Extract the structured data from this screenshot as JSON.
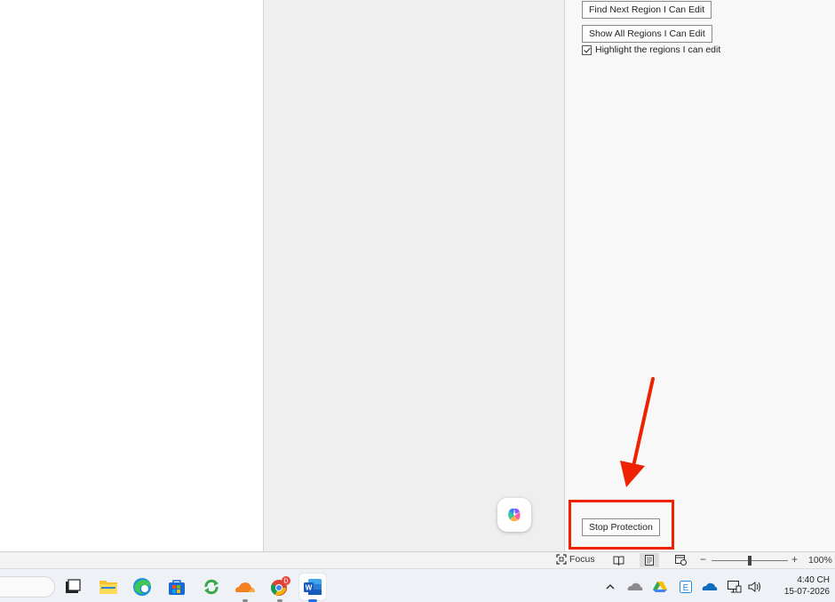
{
  "restrict_editing_pane": {
    "find_next_label": "Find Next Region I Can Edit",
    "show_all_label": "Show All Regions I Can Edit",
    "highlight_label": "Highlight the regions I can edit",
    "highlight_checked": true,
    "stop_protection_label": "Stop Protection"
  },
  "annotation": {
    "color": "#ee2200"
  },
  "status_bar": {
    "focus_label": "Focus",
    "zoom_percent": "100%",
    "zoom_level": 100,
    "active_view": "print-layout"
  },
  "taskbar": {
    "apps": [
      {
        "name": "task-view",
        "icon": "task-view-icon"
      },
      {
        "name": "file-explorer",
        "icon": "folder-icon"
      },
      {
        "name": "edge",
        "icon": "edge-icon"
      },
      {
        "name": "microsoft-store",
        "icon": "store-icon"
      },
      {
        "name": "sync-app",
        "icon": "sync-icon"
      },
      {
        "name": "cloudflare",
        "icon": "cloud-icon"
      },
      {
        "name": "chrome",
        "icon": "chrome-icon",
        "badge": "D"
      },
      {
        "name": "word",
        "icon": "word-icon",
        "active": true
      }
    ],
    "clock_time": "4:40 CH",
    "clock_date": "15-07-2026"
  }
}
